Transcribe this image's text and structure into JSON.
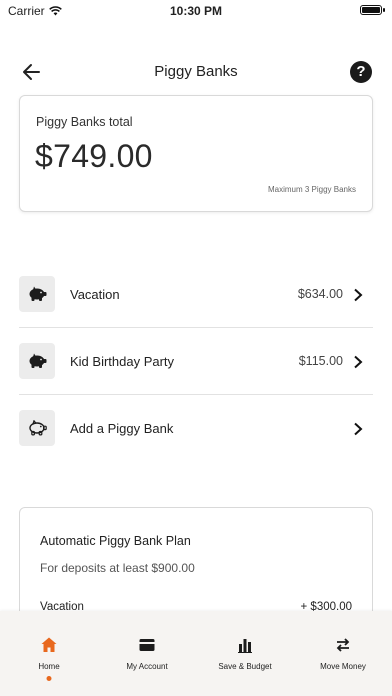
{
  "status_bar": {
    "carrier": "Carrier",
    "time": "10:30 PM"
  },
  "nav": {
    "title": "Piggy Banks",
    "help_glyph": "?"
  },
  "total_card": {
    "label": "Piggy Banks total",
    "amount": "$749.00",
    "limit_note": "Maximum 3 Piggy Banks"
  },
  "banks": [
    {
      "name": "Vacation",
      "value": "$634.00",
      "icon": "piggy-bank-icon"
    },
    {
      "name": "Kid Birthday Party",
      "value": "$115.00",
      "icon": "piggy-bank-icon"
    },
    {
      "name": "Add a Piggy Bank",
      "value": "",
      "icon": "piggy-bank-outline-icon"
    }
  ],
  "plan": {
    "title": "Automatic Piggy Bank Plan",
    "subtitle": "For deposits at least $900.00",
    "rows": [
      {
        "name": "Vacation",
        "value": "+ $300.00"
      }
    ]
  },
  "tabs": [
    {
      "label": "Home",
      "icon": "home-icon",
      "active": true
    },
    {
      "label": "My Account",
      "icon": "card-icon",
      "active": false
    },
    {
      "label": "Save & Budget",
      "icon": "bar-chart-icon",
      "active": false
    },
    {
      "label": "Move Money",
      "icon": "transfer-arrows-icon",
      "active": false
    }
  ],
  "colors": {
    "accent": "#e8681e",
    "text": "#222222",
    "tab_bar_bg": "#f6f4f2"
  }
}
